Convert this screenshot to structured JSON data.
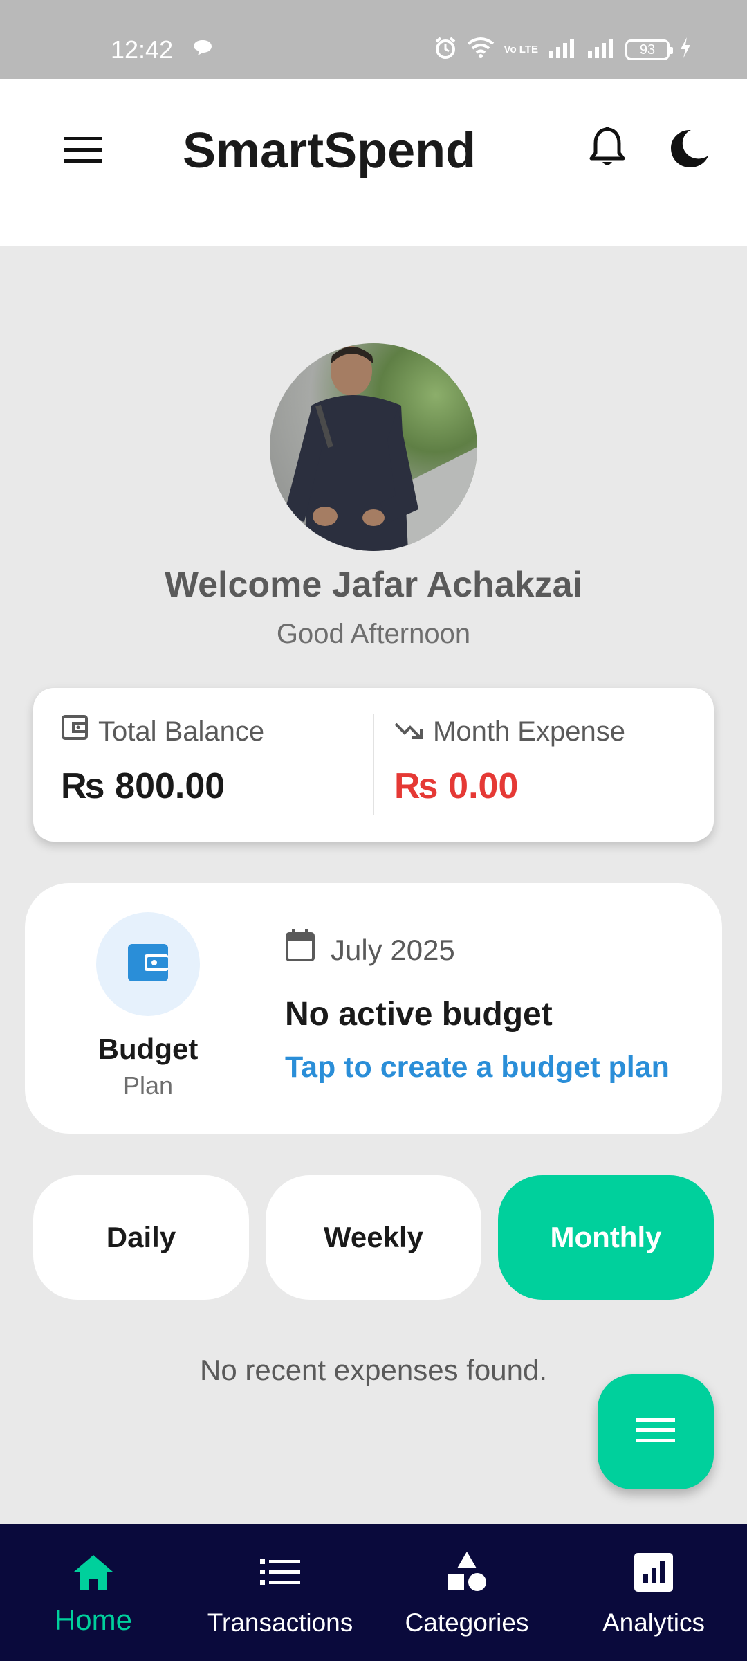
{
  "status_bar": {
    "time": "12:42",
    "battery": "93",
    "network_label": "Vo LTE"
  },
  "header": {
    "title": "SmartSpend"
  },
  "profile": {
    "welcome": "Welcome Jafar Achakzai",
    "greeting": "Good Afternoon"
  },
  "summary": {
    "balance_label": "Total Balance",
    "balance_value": "₨ 800.00",
    "expense_label": "Month Expense",
    "expense_value": "₨ 0.00"
  },
  "budget": {
    "title": "Budget",
    "subtitle": "Plan",
    "month": "July 2025",
    "status": "No active budget",
    "cta": "Tap to create a budget plan"
  },
  "period_tabs": {
    "daily": "Daily",
    "weekly": "Weekly",
    "monthly": "Monthly",
    "selected": "Monthly"
  },
  "recent": {
    "empty_message": "No recent expenses found."
  },
  "bottom_nav": {
    "home": "Home",
    "transactions": "Transactions",
    "categories": "Categories",
    "analytics": "Analytics",
    "active": "Home"
  },
  "colors": {
    "accent": "#00d09c",
    "expense": "#e53935",
    "link": "#2a8ed8",
    "nav_background": "#0a0a3c"
  }
}
